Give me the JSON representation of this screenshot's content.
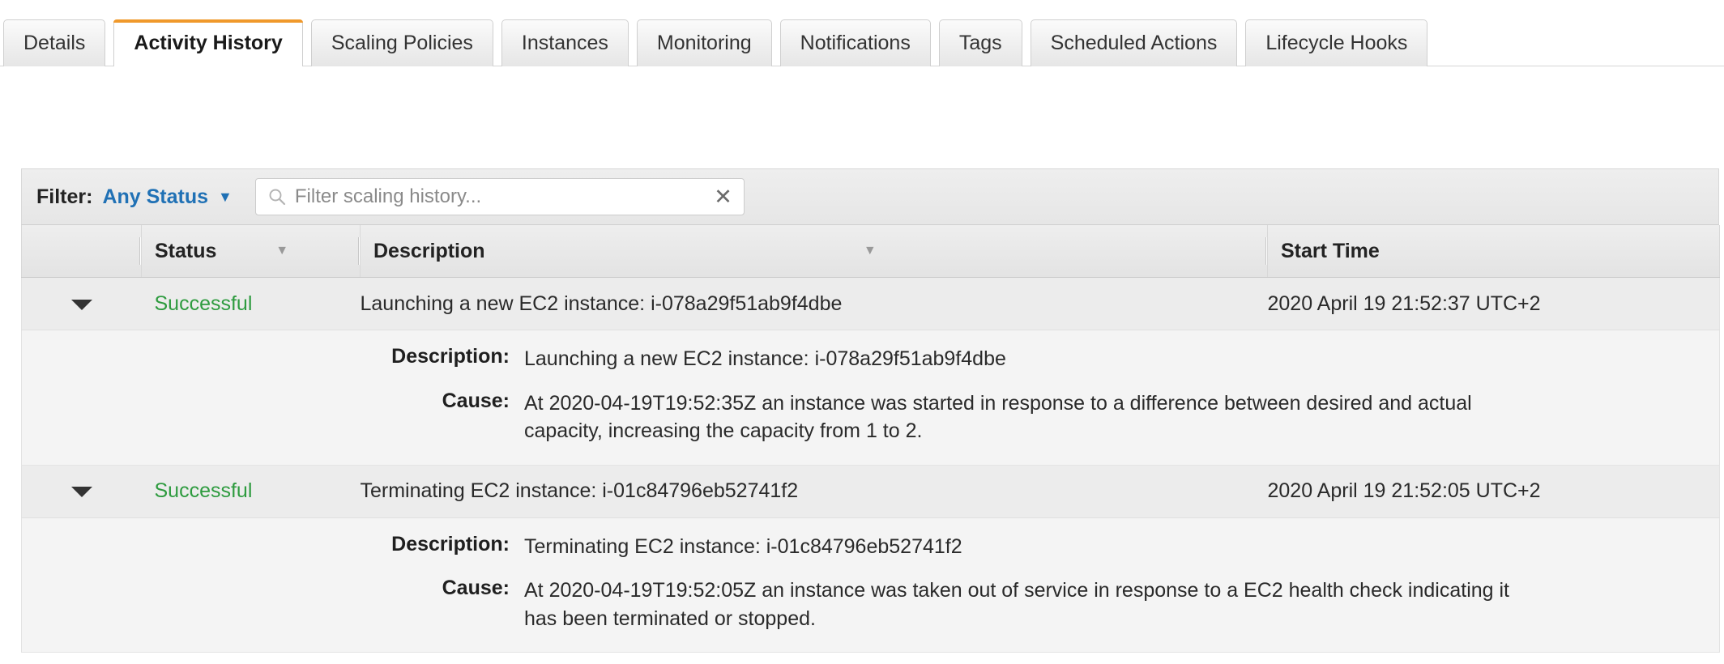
{
  "tabs": [
    {
      "label": "Details",
      "active": false
    },
    {
      "label": "Activity History",
      "active": true
    },
    {
      "label": "Scaling Policies",
      "active": false
    },
    {
      "label": "Instances",
      "active": false
    },
    {
      "label": "Monitoring",
      "active": false
    },
    {
      "label": "Notifications",
      "active": false
    },
    {
      "label": "Tags",
      "active": false
    },
    {
      "label": "Scheduled Actions",
      "active": false
    },
    {
      "label": "Lifecycle Hooks",
      "active": false
    }
  ],
  "filter_bar": {
    "label": "Filter:",
    "status_filter": "Any Status",
    "caret": "▼",
    "search_placeholder": "Filter scaling history...",
    "search_value": "",
    "clear_label": "✕"
  },
  "table": {
    "columns": {
      "toggle": "",
      "status": "Status",
      "description": "Description",
      "start_time": "Start Time"
    },
    "sort_caret": "▼",
    "rows": [
      {
        "toggle": "▼",
        "status": "Successful",
        "description": "Launching a new EC2 instance: i-078a29f51ab9f4dbe",
        "start_time": "2020 April 19 21:52:37 UTC+2",
        "detail": {
          "description_label": "Description:",
          "description_value": "Launching a new EC2 instance: i-078a29f51ab9f4dbe",
          "cause_label": "Cause:",
          "cause_value": "At 2020-04-19T19:52:35Z an instance was started in response to a difference between desired and actual capacity, increasing the capacity from 1 to 2."
        }
      },
      {
        "toggle": "▼",
        "status": "Successful",
        "description": "Terminating EC2 instance: i-01c84796eb52741f2",
        "start_time": "2020 April 19 21:52:05 UTC+2",
        "detail": {
          "description_label": "Description:",
          "description_value": "Terminating EC2 instance: i-01c84796eb52741f2",
          "cause_label": "Cause:",
          "cause_value": "At 2020-04-19T19:52:05Z an instance was taken out of service in response to a EC2 health check indicating it has been terminated or stopped."
        }
      }
    ]
  },
  "colors": {
    "active_tab_accent": "#f0992b",
    "link_blue": "#2071b5",
    "status_success_green": "#2e9b3f"
  }
}
